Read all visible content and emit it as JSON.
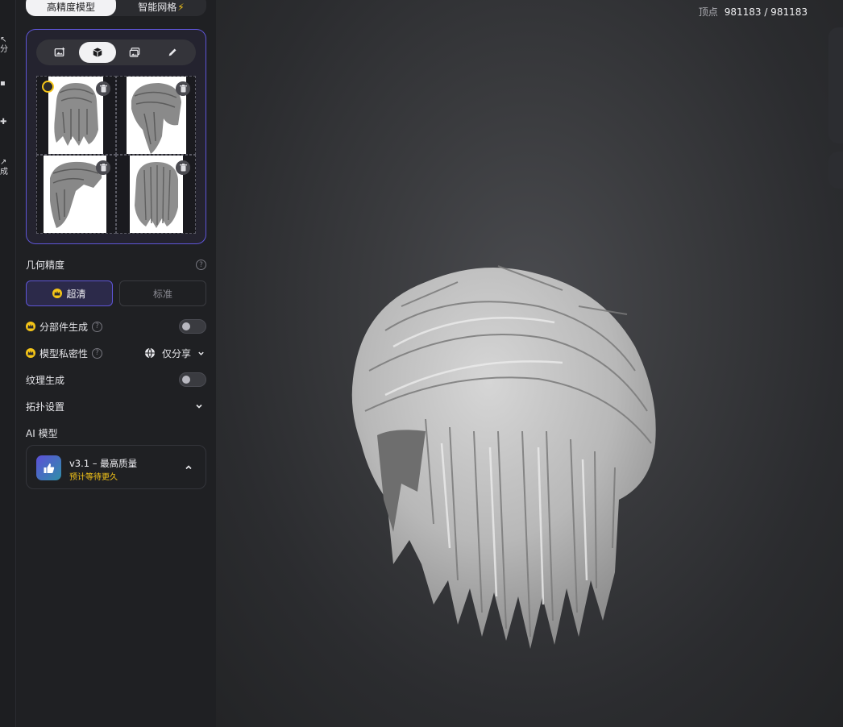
{
  "left_strip": {
    "items": [
      {
        "icon": "arrow-icon",
        "label": "分"
      },
      {
        "icon": "dot-icon",
        "label": ""
      },
      {
        "icon": "body-icon",
        "label": ""
      },
      {
        "icon": "wand-icon",
        "label": "成"
      }
    ]
  },
  "mode_tabs": {
    "high_precision": "高精度模型",
    "smart_mesh": "智能网格",
    "bolt": "⚡"
  },
  "tools": [
    "image-add-icon",
    "cube-icon",
    "gallery-icon",
    "pencil-icon"
  ],
  "settings": {
    "geometry_precision": "几何精度",
    "ultra": "超清",
    "standard": "标准",
    "part_generation": "分部件生成",
    "model_privacy": "模型私密性",
    "privacy_value": "仅分享",
    "texture_generation": "纹理生成",
    "topology_settings": "拓扑设置",
    "ai_model": "AI 模型"
  },
  "model_card": {
    "name": "v3.1 – 最高质量",
    "sub": "预计等待更久"
  },
  "viewport": {
    "vertex_label": "顶点",
    "vertex_value": "981183 / 981183"
  },
  "colors": {
    "accent": "#5e55d6",
    "gold": "#f5c518"
  }
}
